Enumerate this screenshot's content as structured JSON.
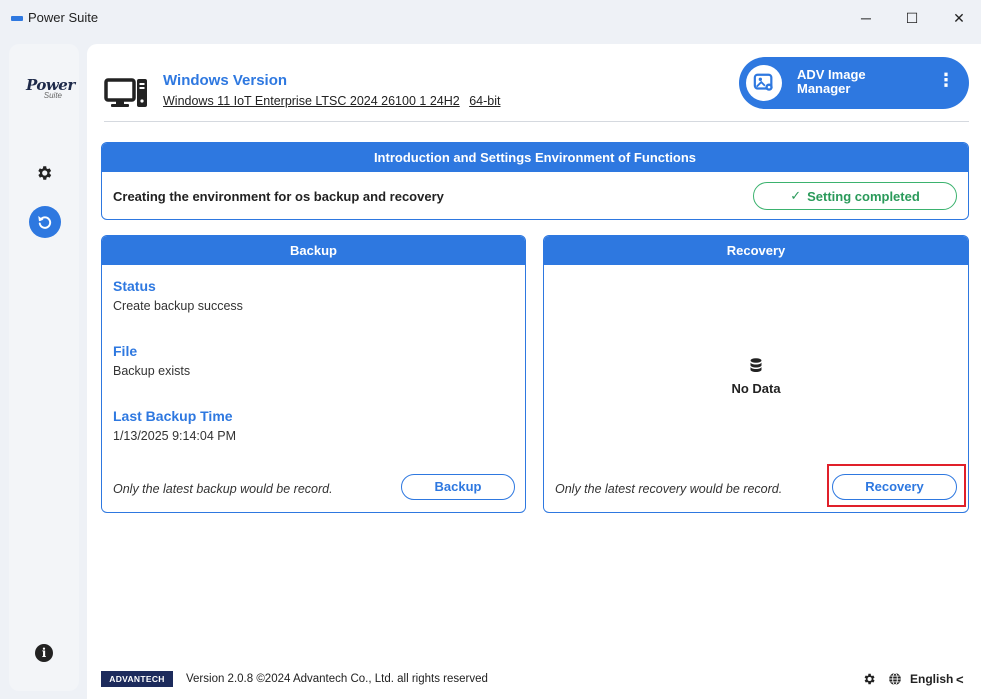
{
  "window": {
    "title": "Power Suite",
    "controls": {
      "minimize": "─",
      "maximize": "☐",
      "close": "✕"
    }
  },
  "sidebar": {
    "logo_main": "Power",
    "logo_sub": "Suite",
    "items": [
      {
        "name": "settings",
        "icon": "gear-icon"
      },
      {
        "name": "backup-recovery",
        "icon": "restore-icon",
        "active": true
      }
    ],
    "info_icon": "i"
  },
  "header": {
    "windows_version_label": "Windows Version",
    "windows_version_value": "Windows 11 IoT Enterprise LTSC 2024 26100 1 24H2",
    "windows_arch": "64-bit",
    "adv_button_label": "ADV Image Manager",
    "adv_more": "⋮"
  },
  "intro": {
    "title": "Introduction and Settings Environment of Functions",
    "description": "Creating the environment for os backup and recovery",
    "status": "Setting completed",
    "status_icon": "✓"
  },
  "backup": {
    "title": "Backup",
    "status_label": "Status",
    "status_value": "Create backup success",
    "file_label": "File",
    "file_value": "Backup exists",
    "last_time_label": "Last Backup Time",
    "last_time_value": "1/13/2025 9:14:04 PM",
    "note": "Only the latest backup would be record.",
    "button": "Backup"
  },
  "recovery": {
    "title": "Recovery",
    "empty_text": "No Data",
    "note": "Only the latest recovery would be record.",
    "button": "Recovery"
  },
  "footer": {
    "brand": "ADVANTECH",
    "version": "Version 2.0.8 ©2024 Advantech Co., Ltd. all rights reserved",
    "language": "English",
    "chevron": "<"
  },
  "colors": {
    "accent": "#2e78e0",
    "success": "#2a9a5a",
    "highlight": "#e0202a",
    "brand": "#1d2b5c"
  }
}
